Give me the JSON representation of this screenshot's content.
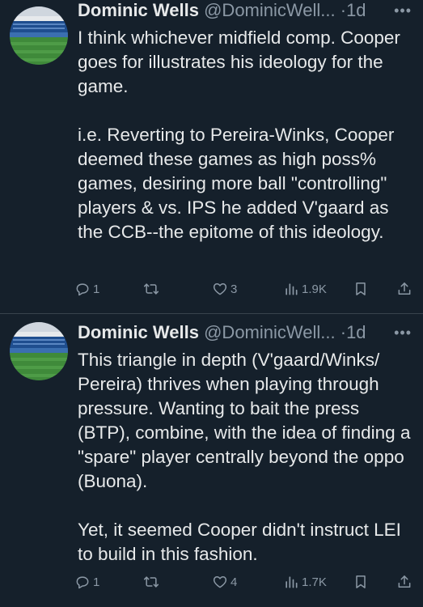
{
  "tweets": [
    {
      "author": {
        "display_name": "Dominic Wells",
        "handle": "@DominicWell...",
        "separator": "·",
        "time": "1d"
      },
      "more_label": "•••",
      "paragraphs": [
        "I think whichever midfield comp. Cooper goes for illustrates his ideology for the game.",
        "i.e. Reverting to Pereira-Winks, Cooper deemed these games as high poss% games, desiring more ball \"controlling\" players & vs. IPS he added V'gaard as the CCB--the epitome of this ideology."
      ],
      "stats": {
        "replies": "1",
        "retweets": "",
        "likes": "3",
        "views": "1.9K"
      }
    },
    {
      "author": {
        "display_name": "Dominic Wells",
        "handle": "@DominicWell...",
        "separator": "·",
        "time": "1d"
      },
      "more_label": "•••",
      "paragraphs": [
        "This triangle in depth (V'gaard/Winks/ Pereira) thrives when playing through pressure. Wanting to bait the press (BTP), combine, with the idea of finding a \"spare\" player centrally beyond the oppo (Buona).",
        "Yet, it seemed Cooper didn't instruct LEI to build in this fashion."
      ],
      "stats": {
        "replies": "1",
        "retweets": "",
        "likes": "4",
        "views": "1.7K"
      }
    }
  ],
  "icons": {
    "reply": "speech-bubble-icon",
    "retweet": "retweet-arrows-icon",
    "like": "heart-icon",
    "views": "bar-chart-icon",
    "bookmark": "bookmark-icon",
    "share": "share-upload-icon"
  },
  "colors": {
    "background": "#15202b",
    "text_primary": "#e7e9ea",
    "text_secondary": "#8b98a5",
    "divider": "#38444d"
  }
}
